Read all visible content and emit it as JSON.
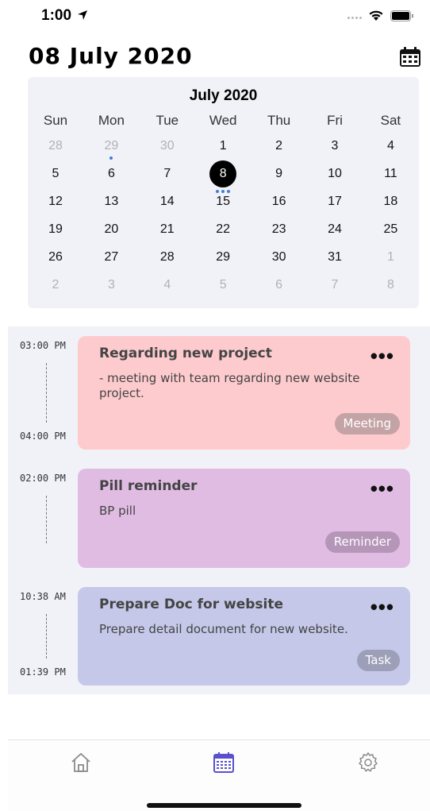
{
  "status_bar": {
    "time": "1:00"
  },
  "header": {
    "date_title": "08 July 2020"
  },
  "calendar": {
    "month_title": "July 2020",
    "weekdays": [
      "Sun",
      "Mon",
      "Tue",
      "Wed",
      "Thu",
      "Fri",
      "Sat"
    ],
    "weeks": [
      [
        {
          "d": "28",
          "m": true
        },
        {
          "d": "29",
          "m": true,
          "dots": 1
        },
        {
          "d": "30",
          "m": true
        },
        {
          "d": "1"
        },
        {
          "d": "2"
        },
        {
          "d": "3"
        },
        {
          "d": "4"
        }
      ],
      [
        {
          "d": "5"
        },
        {
          "d": "6"
        },
        {
          "d": "7"
        },
        {
          "d": "8",
          "sel": true,
          "dots": 3
        },
        {
          "d": "9"
        },
        {
          "d": "10"
        },
        {
          "d": "11"
        }
      ],
      [
        {
          "d": "12"
        },
        {
          "d": "13"
        },
        {
          "d": "14"
        },
        {
          "d": "15"
        },
        {
          "d": "16"
        },
        {
          "d": "17"
        },
        {
          "d": "18"
        }
      ],
      [
        {
          "d": "19"
        },
        {
          "d": "20"
        },
        {
          "d": "21"
        },
        {
          "d": "22"
        },
        {
          "d": "23"
        },
        {
          "d": "24"
        },
        {
          "d": "25"
        }
      ],
      [
        {
          "d": "26"
        },
        {
          "d": "27"
        },
        {
          "d": "28"
        },
        {
          "d": "29"
        },
        {
          "d": "30"
        },
        {
          "d": "31"
        },
        {
          "d": "1",
          "m": true
        }
      ],
      [
        {
          "d": "2",
          "m": true
        },
        {
          "d": "3",
          "m": true
        },
        {
          "d": "4",
          "m": true
        },
        {
          "d": "5",
          "m": true
        },
        {
          "d": "6",
          "m": true
        },
        {
          "d": "7",
          "m": true
        },
        {
          "d": "8",
          "m": true
        }
      ]
    ],
    "dot_color": "#3f7fd8"
  },
  "events": [
    {
      "start": "03:00 PM",
      "end": "04:00 PM",
      "title": "Regarding new project",
      "description": "- meeting with team regarding new website project.",
      "tag": "Meeting",
      "bg_color": "#fdcbce",
      "tag_color": "#c4a3a6"
    },
    {
      "start": "02:00 PM",
      "end": "",
      "title": "Pill reminder",
      "description": "BP pill",
      "tag": "Reminder",
      "bg_color": "#e0bce3",
      "tag_color": "#b596b8"
    },
    {
      "start": "10:38 AM",
      "end": "01:39 PM",
      "title": "Prepare Doc for website",
      "description": "Prepare detail document for new website.",
      "tag": "Task",
      "bg_color": "#c5c8e8",
      "tag_color": "#9c9fb7"
    }
  ],
  "more_label": "•••",
  "tab_bar": {
    "items": [
      {
        "icon": "home-icon",
        "active": false
      },
      {
        "icon": "calendar-icon",
        "active": true
      },
      {
        "icon": "gear-icon",
        "active": false
      }
    ],
    "active_color": "#5a4fcf",
    "inactive_color": "#8a8a8a"
  }
}
